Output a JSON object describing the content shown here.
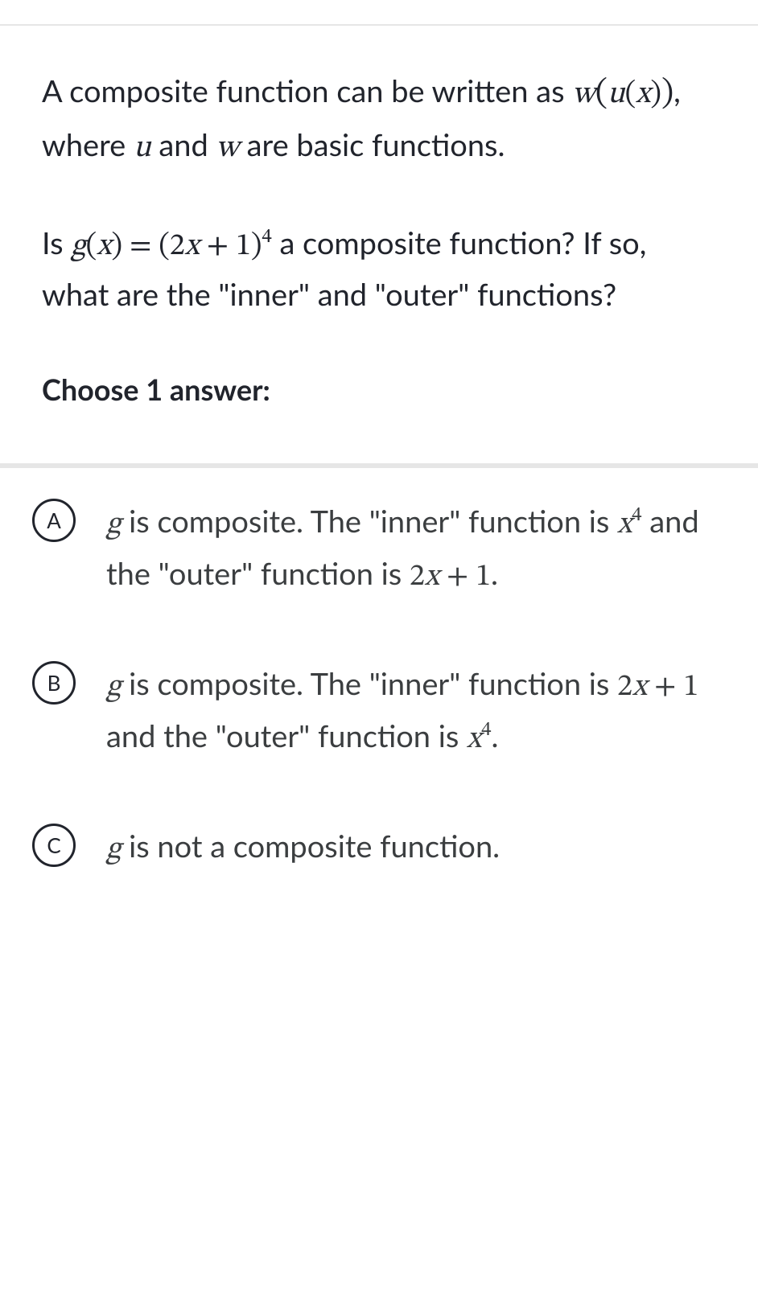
{
  "prompt": {
    "part1": "A composite function can be written as ",
    "math1_w": "w",
    "math1_open": "(",
    "math1_u": "u",
    "math1_open2": "(",
    "math1_x": "x",
    "math1_close2": ")",
    "math1_close": ")",
    "part2": ", where ",
    "math2_u": "u",
    "part3": " and ",
    "math2_w": "w",
    "part4": " are basic functions."
  },
  "question": {
    "part1": "Is ",
    "m_g": "g",
    "m_open": "(",
    "m_x": "x",
    "m_close": ")",
    "m_eq": " = ",
    "m_open2": "(",
    "m_2x": "2",
    "m_xvar": "x",
    "m_plus": " + ",
    "m_1": "1",
    "m_close2": ")",
    "m_exp": "4",
    "part2": " a composite function? If so, what are the \"inner\" and \"outer\" functions?"
  },
  "choose_label": "Choose 1 answer:",
  "answers": {
    "a": {
      "letter": "A",
      "t1": "g",
      "t2": " is composite. The \"inner\" function is ",
      "t3_x": "x",
      "t3_exp": "4",
      "t4": " and the \"outer\" function is ",
      "t5_2": "2",
      "t5_x": "x",
      "t5_plus": " + ",
      "t5_1": "1",
      "t6": "."
    },
    "b": {
      "letter": "B",
      "t1": "g",
      "t2": " is composite. The \"inner\" function is ",
      "t3_2": "2",
      "t3_x": "x",
      "t3_plus": " + ",
      "t3_1": "1",
      "t4": " and the \"outer\" function is ",
      "t5_x": "x",
      "t5_exp": "4",
      "t6": "."
    },
    "c": {
      "letter": "C",
      "t1": "g",
      "t2": " is not a composite function."
    }
  }
}
